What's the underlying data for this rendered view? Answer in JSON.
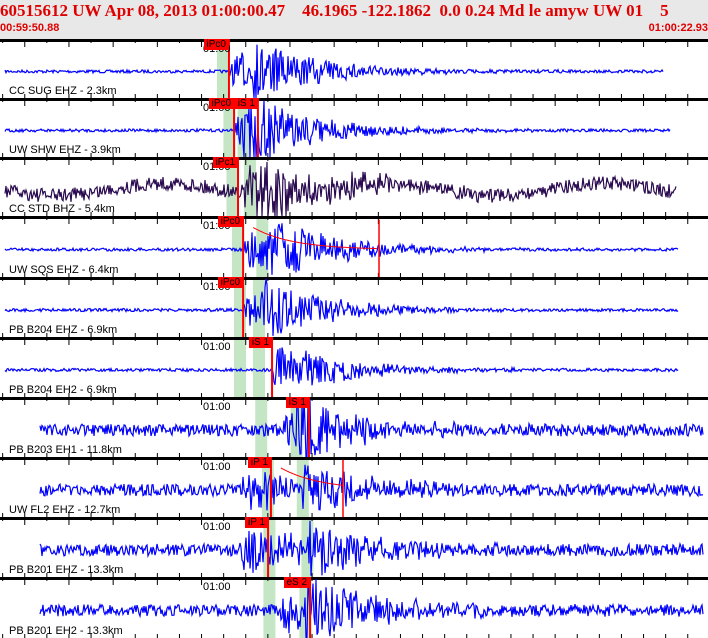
{
  "header": {
    "title": "60515612 UW Apr 08, 2013 01:00:00.47    46.1965 -122.1862  0.0 0.24 Md le amyw UW 01    5",
    "start_time": "00:59:50.88",
    "end_time": "01:00:22.93"
  },
  "time_tick_label": "01:00",
  "colors": {
    "trace": "#0000ff",
    "trace_broadband": "#2a0a50",
    "pick": "#ff0000",
    "band": "#c4e6c4"
  },
  "panels": [
    {
      "label": "CC SUG EHZ - 2.3km",
      "picks": [
        {
          "label": "iPc0",
          "time": "01:00:01.24"
        }
      ],
      "p_band": "01:00:00.97",
      "s_band": null,
      "amp": 22,
      "end": "01:00:20.90",
      "color": "trace"
    },
    {
      "label": "UW SHW EHZ - 3.9km",
      "picks": [
        {
          "label": "iPc0",
          "time": "01:00:01.47"
        },
        {
          "label": "iS 1",
          "time": "01:00:02.55"
        }
      ],
      "p_band": "01:00:01.26",
      "s_band": "01:00:01.90",
      "amp": 24,
      "end": "01:00:21.20",
      "color": "trace"
    },
    {
      "label": "CC STD BHZ - 5.4km",
      "picks": [
        {
          "label": "iPc1",
          "time": "01:00:01.65"
        }
      ],
      "p_band": "01:00:01.40",
      "s_band": "01:00:02.19",
      "amp": 24,
      "end": "01:00:21.50",
      "color": "trace_broadband"
    },
    {
      "label": "UW SQS EHZ - 6.4km",
      "picks": [
        {
          "label": "iPc0",
          "time": "01:00:01.88"
        }
      ],
      "p_band": "01:00:01.65",
      "s_band": "01:00:02.75",
      "amp": 26,
      "end": "01:00:21.60",
      "color": "trace",
      "coda": "01:00:08.03"
    },
    {
      "label": "PB B204 EHZ - 6.9km",
      "picks": [
        {
          "label": "iPc0",
          "time": "01:00:01.88"
        }
      ],
      "p_band": "01:00:01.74",
      "s_band": "01:00:02.60",
      "amp": 22,
      "end": "01:00:21.60",
      "color": "trace"
    },
    {
      "label": "PB B204 EH2 - 6.9km",
      "picks": [
        {
          "label": "iS 1",
          "time": "01:00:03.19"
        }
      ],
      "p_band": "01:00:01.74",
      "s_band": "01:00:02.60",
      "amp": 20,
      "end": "01:00:21.60",
      "color": "trace"
    },
    {
      "label": "PB B203 EH1 - 11.8km",
      "picks": [
        {
          "label": "iS 1",
          "time": "01:00:04.86"
        }
      ],
      "p_band": "01:00:02.70",
      "s_band": "01:00:04.30",
      "amp": 22,
      "end": "01:00:22.70",
      "color": "trace"
    },
    {
      "label": "UW FL2 EHZ - 12.7km",
      "picks": [
        {
          "label": "iP 1",
          "time": "01:00:03.14"
        }
      ],
      "p_band": "01:00:03.00",
      "s_band": "01:00:04.58",
      "amp": 24,
      "end": "01:00:22.70",
      "color": "trace",
      "coda": "01:00:06.40"
    },
    {
      "label": "PB B201 EHZ - 13.3km",
      "picks": [
        {
          "label": "iP 1",
          "time": "01:00:03.01"
        }
      ],
      "p_band": "01:00:03.07",
      "s_band": "01:00:04.79",
      "amp": 26,
      "end": "01:00:22.70",
      "color": "trace"
    },
    {
      "label": "PB B201 EH2 - 13.3km",
      "picks": [
        {
          "label": "eS 2",
          "time": "01:00:04.91"
        }
      ],
      "p_band": "01:00:03.07",
      "s_band": "01:00:04.70",
      "amp": 26,
      "end": "01:00:22.70",
      "color": "trace"
    }
  ]
}
